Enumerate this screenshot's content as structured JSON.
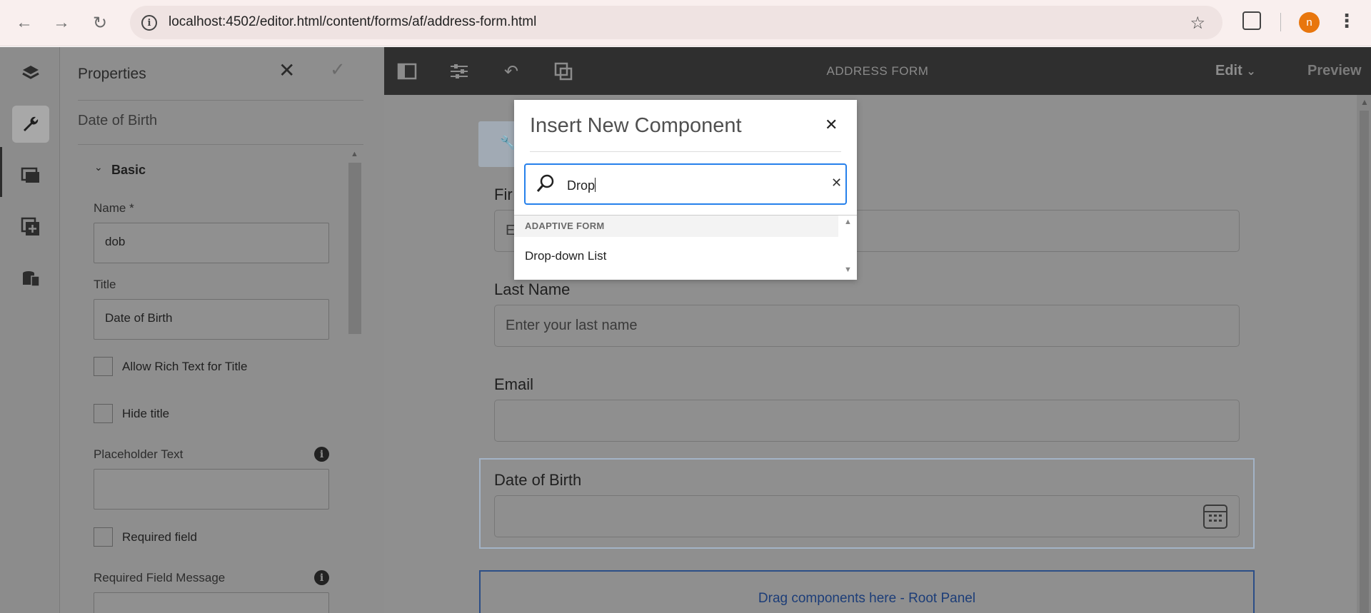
{
  "browser": {
    "url": "localhost:4502/editor.html/content/forms/af/address-form.html",
    "profile_initial": "n"
  },
  "properties": {
    "title": "Properties",
    "component_name": "Date of Birth",
    "section": "Basic",
    "name_label": "Name *",
    "name_value": "dob",
    "title_label": "Title",
    "title_value": "Date of Birth",
    "rich_text_label": "Allow Rich Text for Title",
    "hide_title_label": "Hide title",
    "placeholder_label": "Placeholder Text",
    "required_label": "Required field",
    "required_msg_label": "Required Field Message"
  },
  "editor": {
    "form_title": "ADDRESS FORM",
    "mode": "Edit",
    "preview": "Preview"
  },
  "form": {
    "first_name_label": "Fir",
    "first_name_placeholder": "E",
    "last_name_label": "Last Name",
    "last_name_placeholder": "Enter your last name",
    "email_label": "Email",
    "dob_label": "Date of Birth",
    "root_panel_text": "Drag components here - Root Panel"
  },
  "modal": {
    "title": "Insert New Component",
    "search_value": "Drop",
    "group": "ADAPTIVE FORM",
    "results": [
      "Drop-down List"
    ]
  },
  "colors": {
    "accent": "#2680eb",
    "avatar": "#e8760d",
    "root_panel_border": "#2c4e87"
  }
}
